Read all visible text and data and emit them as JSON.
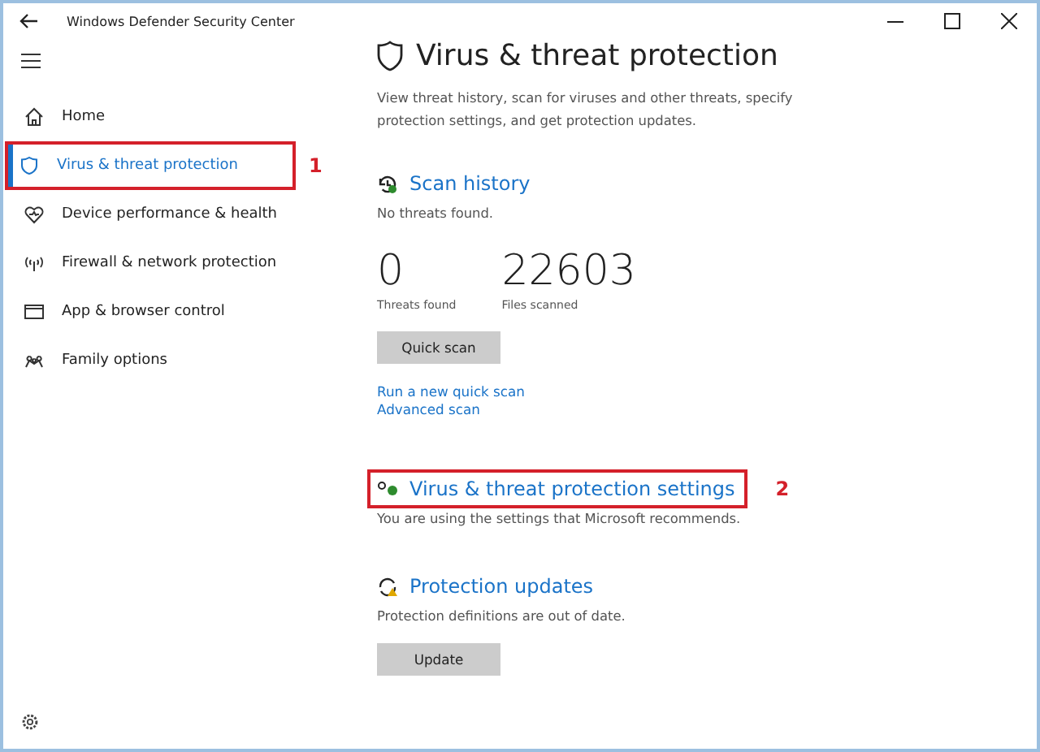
{
  "window": {
    "title": "Windows Defender Security Center"
  },
  "sidebar": {
    "items": [
      {
        "label": "Home",
        "kind": "home",
        "selected": false
      },
      {
        "label": "Virus & threat protection",
        "kind": "shield",
        "selected": true,
        "callout": "1"
      },
      {
        "label": "Device performance & health",
        "kind": "heart",
        "selected": false
      },
      {
        "label": "Firewall & network protection",
        "kind": "antenna",
        "selected": false
      },
      {
        "label": "App & browser control",
        "kind": "window",
        "selected": false
      },
      {
        "label": "Family options",
        "kind": "family",
        "selected": false
      }
    ]
  },
  "page": {
    "title": "Virus & threat protection",
    "description": "View threat history, scan for viruses and other threats, specify protection settings, and get protection updates."
  },
  "scan_history": {
    "heading": "Scan history",
    "status": "No threats found.",
    "stats": [
      {
        "value": "0",
        "label": "Threats found"
      },
      {
        "value": "22603",
        "label": "Files scanned"
      }
    ],
    "button": "Quick scan",
    "links": [
      "Run a new quick scan",
      "Advanced scan"
    ]
  },
  "settings": {
    "heading": "Virus & threat protection settings",
    "status": "You are using the settings that Microsoft recommends.",
    "callout": "2"
  },
  "updates": {
    "heading": "Protection updates",
    "status": "Protection definitions are out of date.",
    "button": "Update"
  }
}
